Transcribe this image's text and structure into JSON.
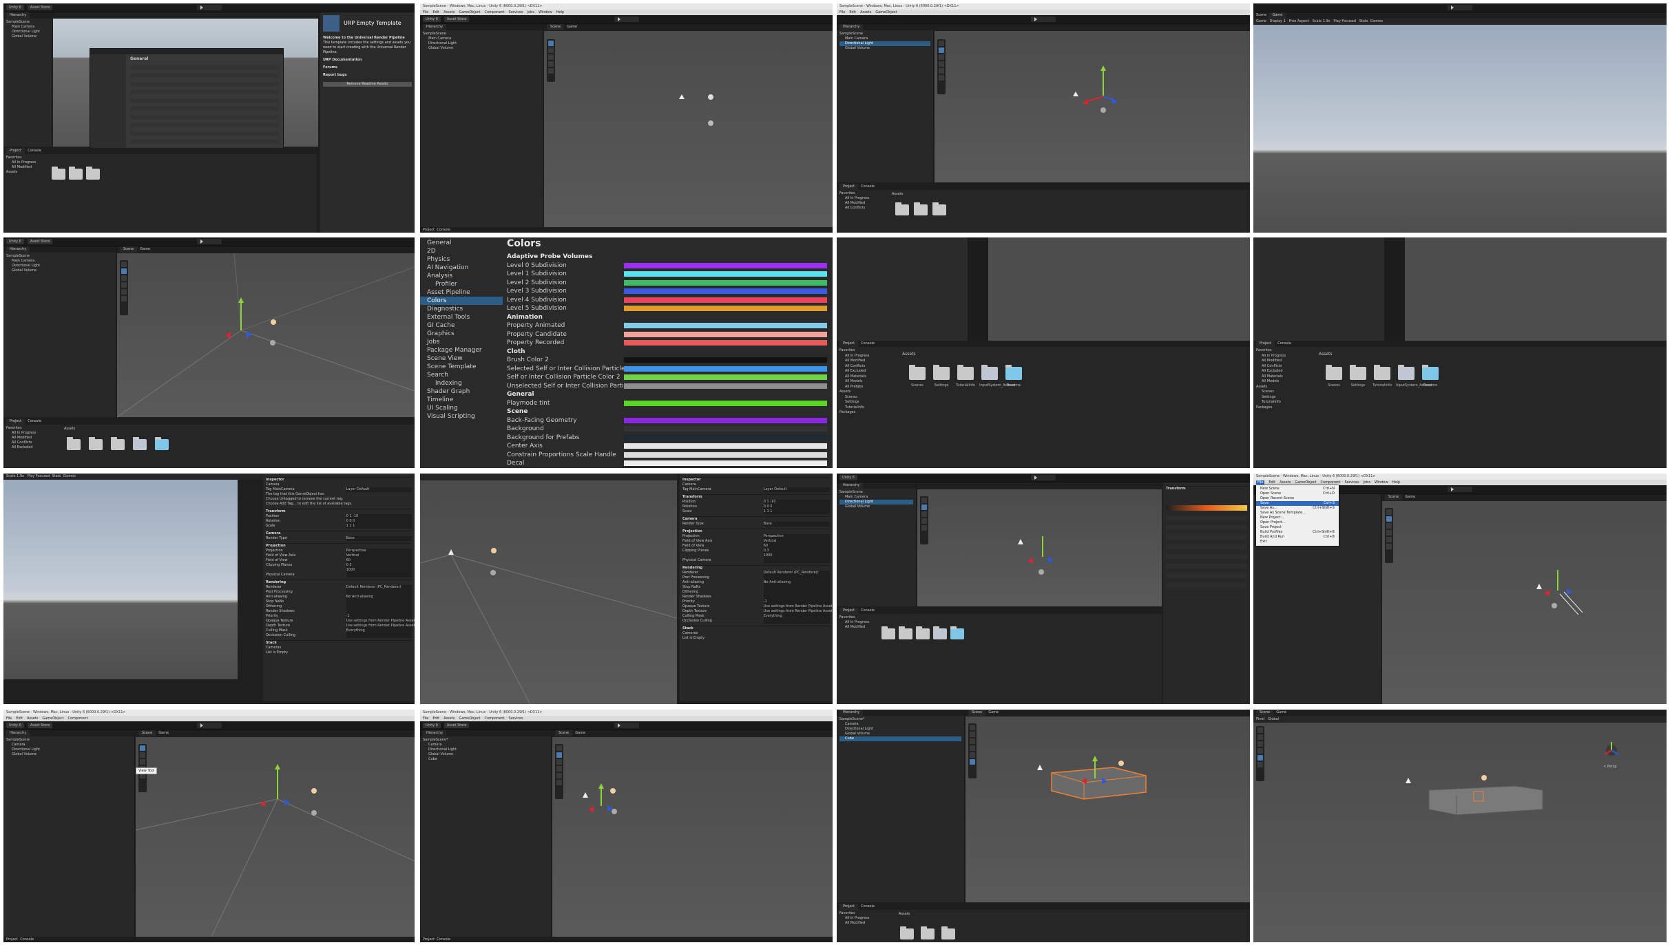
{
  "app": {
    "title": "SampleScene - Windows, Mac, Linux - Unity 6 (6000.0.29f1) <DX11>",
    "menu": [
      "File",
      "Edit",
      "Assets",
      "GameObject",
      "Component",
      "Services",
      "Jobs",
      "Window",
      "Help"
    ],
    "account": "Unity 6",
    "asset_store": "Asset Store",
    "tabs": {
      "hierarchy": "Hierarchy",
      "scene": "Scene",
      "game": "Game",
      "project": "Project",
      "console": "Console",
      "inspector": "Inspector"
    },
    "scene_tools": {
      "pivot": "Pivot",
      "global": "Global",
      "persp": "< Persp"
    }
  },
  "hierarchy": {
    "root": "SampleScene",
    "root_dirty": "SampleScene*",
    "items": [
      "Main Camera",
      "Directional Light",
      "Global Volume"
    ],
    "items_renamed": [
      "Camera",
      "Directional Light",
      "Global Volume"
    ],
    "items_with_cube": [
      "Camera",
      "Directional Light",
      "Global Volume",
      "Cube"
    ]
  },
  "project": {
    "favorites": "Favorites",
    "favorite_items": [
      "All In Progress",
      "All Modified",
      "All Conflicts",
      "All Excluded",
      "All Materials",
      "All Models",
      "All Prefabs"
    ],
    "assets_label": "Assets",
    "asset_folders": [
      "Scenes",
      "Settings",
      "TutorialInfo",
      "InputSystem_Actions",
      "Readme"
    ],
    "sidebar_assets": [
      "Assets",
      "Scenes",
      "Settings",
      "TutorialInfo",
      "Packages"
    ]
  },
  "game_view": {
    "display": "Display 1",
    "aspect": "Free Aspect",
    "scale_label": "Scale",
    "scale_value": "1.9x",
    "play_mode": "Play Focused",
    "stats": "Stats",
    "gizmos": "Gizmos"
  },
  "welcome": {
    "title": "URP Empty Template",
    "heading": "Welcome to the Universal Render Pipeline",
    "body": "This template includes the settings and assets you need to start creating with the Universal Render Pipeline.",
    "doc_label": "URP Documentation",
    "forums": "Forums",
    "report": "Report bugs",
    "button": "Remove Readme Assets"
  },
  "preferences": {
    "sidebar": [
      "General",
      "2D",
      "Physics",
      "AI Navigation",
      "Analysis",
      "Profiler",
      "Asset Pipeline",
      "Colors",
      "Diagnostics",
      "External Tools",
      "GI Cache",
      "Graphics",
      "Jobs",
      "Package Manager",
      "Scene View",
      "Scene Template",
      "Search",
      "Indexing",
      "Shader Graph",
      "Timeline",
      "UI Scaling",
      "Visual Scripting"
    ],
    "sidebar_sub": [
      "Profiler",
      "Indexing"
    ],
    "selected": "Colors",
    "title": "Colors",
    "rows": [
      {
        "label": "Adaptive Probe Volumes",
        "header": true
      },
      {
        "label": "Level 0 Subdivision",
        "color": "#9b2ff0"
      },
      {
        "label": "Level 1 Subdivision",
        "color": "#59e2ee"
      },
      {
        "label": "Level 2 Subdivision",
        "color": "#3ac063"
      },
      {
        "label": "Level 3 Subdivision",
        "color": "#3b5ae8"
      },
      {
        "label": "Level 4 Subdivision",
        "color": "#e6455c"
      },
      {
        "label": "Level 5 Subdivision",
        "color": "#e59b2c"
      },
      {
        "label": "Animation",
        "header": true
      },
      {
        "label": "Property Animated",
        "color": "#84cbe8"
      },
      {
        "label": "Property Candidate",
        "color": "#f2a49c"
      },
      {
        "label": "Property Recorded",
        "color": "#e85a58"
      },
      {
        "label": "Cloth",
        "header": true
      },
      {
        "label": "Brush Color 2",
        "color": "#111111"
      },
      {
        "label": "Selected Self or Inter Collision Particle Color",
        "color": "#3d93e6"
      },
      {
        "label": "Self or Inter Collision Particle Color 2",
        "color": "#6fd347"
      },
      {
        "label": "Unselected Self or Inter Collision Particle Color",
        "color": "#8e8e8e"
      },
      {
        "label": "General",
        "header": true
      },
      {
        "label": "Playmode tint",
        "color": "#5ad627"
      },
      {
        "label": "Scene",
        "header": true
      },
      {
        "label": "Back-Facing Geometry",
        "color": "#8a27e0"
      },
      {
        "label": "Background",
        "color": "#333333"
      },
      {
        "label": "Background for Prefabs",
        "color": "#1f2a33"
      },
      {
        "label": "Center Axis",
        "color": "#e6e6e6"
      },
      {
        "label": "Constrain Proportions Scale Handle",
        "color": "#dcdcdc"
      },
      {
        "label": "Decal",
        "color": "#ededed"
      }
    ]
  },
  "inspector": {
    "object": "Camera",
    "tag_label": "Tag",
    "tag": "MainCamera",
    "layer_label": "Layer",
    "layer": "Default",
    "static": "Static",
    "tip1": "The tag that this GameObject has",
    "tip2": "Choose Untagged to remove the current tag.",
    "tip3": "Choose Add Tag... to edit the list of available tags.",
    "transform": "Transform",
    "position": "Position",
    "rotation": "Rotation",
    "scale": "Scale",
    "camera": "Camera",
    "render_type": [
      "Render Type",
      "Base"
    ],
    "projection": "Projection",
    "proj_rows": [
      [
        "Projection",
        "Perspective"
      ],
      [
        "Field of View Axis",
        "Vertical"
      ],
      [
        "Field of View",
        "60"
      ],
      [
        "Clipping Planes",
        "0.3"
      ],
      [
        "",
        "1000"
      ],
      [
        "Physical Camera",
        ""
      ]
    ],
    "rendering": "Rendering",
    "rend_rows": [
      [
        "Renderer",
        "Default Renderer (PC_Renderer)"
      ],
      [
        "Post Processing",
        ""
      ],
      [
        "Anti-aliasing",
        "No Anti-aliasing"
      ],
      [
        "Stop NaNs",
        ""
      ],
      [
        "Dithering",
        ""
      ],
      [
        "Render Shadows",
        ""
      ],
      [
        "Priority",
        "-1"
      ],
      [
        "Opaque Texture",
        "Use settings from Render Pipeline Asset"
      ],
      [
        "Depth Texture",
        "Use settings from Render Pipeline Asset"
      ],
      [
        "Culling Mask",
        "Everything"
      ],
      [
        "Occlusion Culling",
        ""
      ]
    ],
    "stack": "Stack",
    "cameras": "Cameras",
    "list_empty": "List is Empty"
  },
  "file_menu": [
    {
      "label": "New Scene",
      "key": "Ctrl+N"
    },
    {
      "label": "Open Scene",
      "key": "Ctrl+O"
    },
    {
      "label": "Open Recent Scene",
      "key": ""
    },
    {
      "label": "Save",
      "key": "Ctrl+S",
      "hl": true
    },
    {
      "label": "Save As...",
      "key": "Ctrl+Shift+S"
    },
    {
      "label": "Save As Scene Template...",
      "key": ""
    },
    {
      "label": "New Project...",
      "key": ""
    },
    {
      "label": "Open Project...",
      "key": ""
    },
    {
      "label": "Save Project",
      "key": ""
    },
    {
      "label": "Build Profiles",
      "key": "Ctrl+Shift+B"
    },
    {
      "label": "Build And Run",
      "key": "Ctrl+B"
    },
    {
      "label": "Exit",
      "key": ""
    }
  ],
  "tooltips": {
    "view_tool": "View Tool"
  },
  "colors": {
    "selection": "#2c5d87",
    "panel": "#282828",
    "gizmo_x": "#d8262e",
    "gizmo_y": "#8fd23a",
    "gizmo_z": "#2e59d9",
    "cube_outline": "#f08030"
  }
}
